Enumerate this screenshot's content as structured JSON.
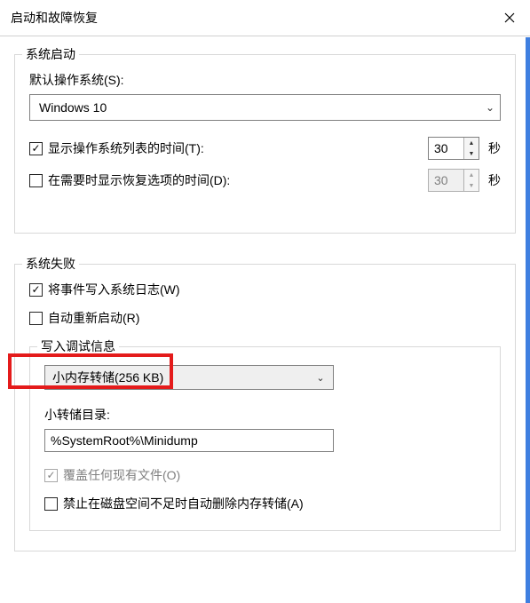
{
  "title": "启动和故障恢复",
  "system_startup": {
    "group_label": "系统启动",
    "default_os_label": "默认操作系统(S):",
    "default_os_value": "Windows 10",
    "show_os_list": {
      "checked": true,
      "label": "显示操作系统列表的时间(T):",
      "seconds": "30",
      "unit": "秒"
    },
    "show_recovery": {
      "checked": false,
      "label": "在需要时显示恢复选项的时间(D):",
      "seconds": "30",
      "unit": "秒"
    }
  },
  "system_failure": {
    "group_label": "系统失败",
    "write_event_log": {
      "checked": true,
      "label": "将事件写入系统日志(W)"
    },
    "auto_restart": {
      "checked": false,
      "label": "自动重新启动(R)"
    },
    "debug_info": {
      "group_label": "写入调试信息",
      "type_value": "小内存转储(256 KB)",
      "dir_label": "小转储目录:",
      "dir_value": "%SystemRoot%\\Minidump",
      "overwrite": {
        "checked": true,
        "enabled": false,
        "label": "覆盖任何现有文件(O)"
      },
      "disable_on_low_disk": {
        "checked": false,
        "label": "禁止在磁盘空间不足时自动删除内存转储(A)"
      }
    }
  }
}
